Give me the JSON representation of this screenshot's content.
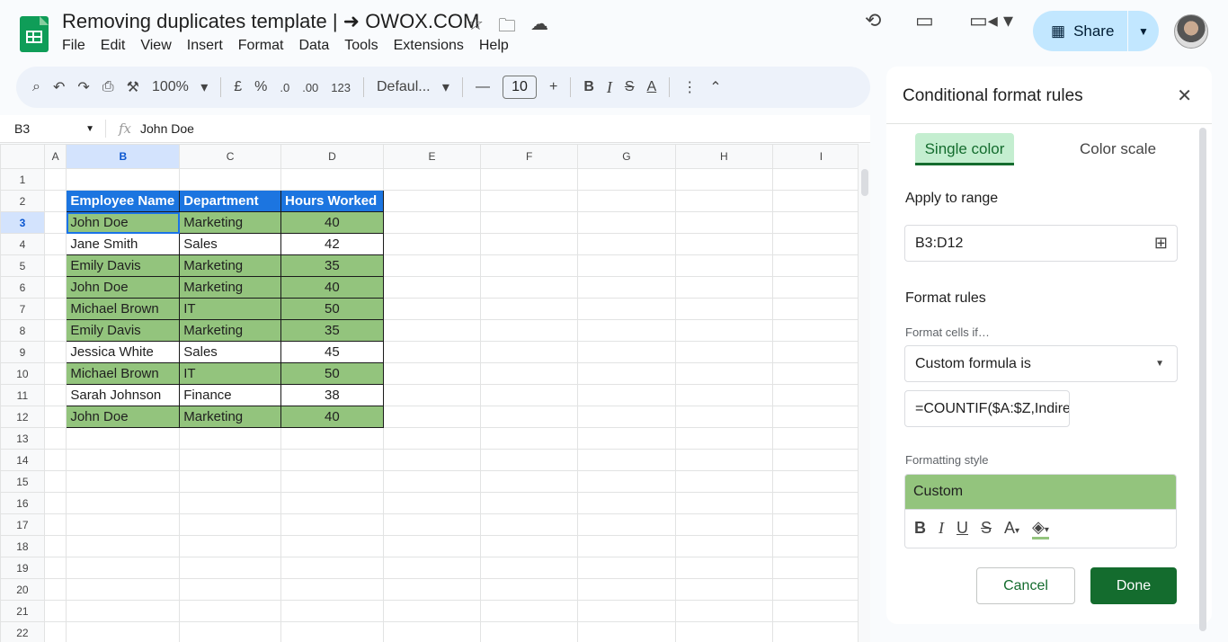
{
  "doc": {
    "title": "Removing duplicates template | ➜ OWOX.COM"
  },
  "menu": [
    "File",
    "Edit",
    "View",
    "Insert",
    "Format",
    "Data",
    "Tools",
    "Extensions",
    "Help"
  ],
  "share": {
    "label": "Share"
  },
  "toolbar": {
    "zoom": "100%",
    "currency": "£",
    "percent": "%",
    "dec_dec": ".0",
    "inc_dec": ".00",
    "number_format": "123",
    "font": "Defaul...",
    "font_size": "10"
  },
  "formula_bar": {
    "cell_ref": "B3",
    "value": "John Doe"
  },
  "sheet": {
    "columns": [
      "A",
      "B",
      "C",
      "D",
      "E",
      "F",
      "G",
      "H",
      "I"
    ],
    "rows": [
      "1",
      "2",
      "3",
      "4",
      "5",
      "6",
      "7",
      "8",
      "9",
      "10",
      "11",
      "12",
      "13",
      "14",
      "15",
      "16",
      "17",
      "18",
      "19",
      "20",
      "21",
      "22"
    ],
    "headers": [
      "Employee Name",
      "Department",
      "Hours Worked"
    ],
    "data": [
      {
        "name": "John Doe",
        "dept": "Marketing",
        "hours": "40"
      },
      {
        "name": "Jane Smith",
        "dept": "Sales",
        "hours": "42"
      },
      {
        "name": "Emily Davis",
        "dept": "Marketing",
        "hours": "35"
      },
      {
        "name": "John Doe",
        "dept": "Marketing",
        "hours": "40"
      },
      {
        "name": "Michael Brown",
        "dept": "IT",
        "hours": "50"
      },
      {
        "name": "Emily Davis",
        "dept": "Marketing",
        "hours": "35"
      },
      {
        "name": "Jessica White",
        "dept": "Sales",
        "hours": "45"
      },
      {
        "name": "Michael Brown",
        "dept": "IT",
        "hours": "50"
      },
      {
        "name": "Sarah Johnson",
        "dept": "Finance",
        "hours": "38"
      },
      {
        "name": "John Doe",
        "dept": "Marketing",
        "hours": "40"
      }
    ],
    "highlighted": [
      true,
      false,
      true,
      true,
      true,
      true,
      false,
      true,
      false,
      true
    ],
    "colors": {
      "header": "#1c75e0",
      "highlight": "#93c47d"
    }
  },
  "panel": {
    "title": "Conditional format rules",
    "tab_single": "Single color",
    "tab_scale": "Color scale",
    "apply_label": "Apply to range",
    "range": "B3:D12",
    "rules_label": "Format rules",
    "cells_if_label": "Format cells if…",
    "condition": "Custom formula is",
    "formula": "=COUNTIF($A:$Z,Indire",
    "style_label": "Formatting style",
    "style_preview": "Custom",
    "cancel": "Cancel",
    "done": "Done",
    "accent": "#146c2e"
  }
}
